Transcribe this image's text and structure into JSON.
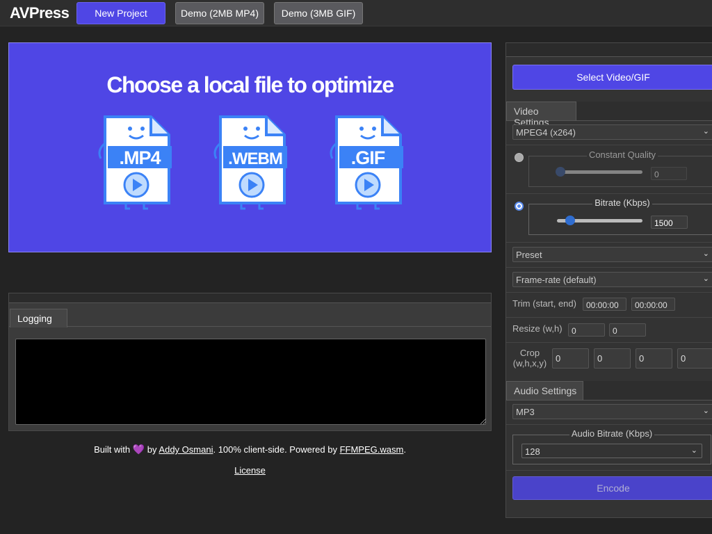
{
  "app": {
    "title": "AVPress"
  },
  "toolbar": {
    "new_project": "New Project",
    "demo_mp4": "Demo (2MB MP4)",
    "demo_gif": "Demo (3MB GIF)"
  },
  "dropzone": {
    "title": "Choose a local file to optimize",
    "files": [
      ".MP4",
      ".WEBM",
      ".GIF"
    ]
  },
  "logging": {
    "tab": "Logging",
    "content": ""
  },
  "footer": {
    "built_with": "Built with",
    "by": "by",
    "author": "Addy Osmani",
    "middle": ". 100% client-side. Powered by",
    "ffmpeg": "FFMPEG.wasm",
    "end": ".",
    "license": "License"
  },
  "settings": {
    "select_button": "Select Video/GIF",
    "video_tab": "Video Settings",
    "codec": "MPEG4 (x264)",
    "constant_quality": {
      "label": "Constant Quality",
      "value": "0",
      "selected": false
    },
    "bitrate": {
      "label": "Bitrate (Kbps)",
      "value": "1500",
      "selected": true
    },
    "preset": "Preset",
    "framerate": "Frame-rate (default)",
    "trim": {
      "label": "Trim (start, end)",
      "start": "00:00:00",
      "end": "00:00:00"
    },
    "resize": {
      "label": "Resize (w,h)",
      "w": "0",
      "h": "0"
    },
    "crop": {
      "label_line1": "Crop",
      "label_line2": "(w,h,x,y)",
      "w": "0",
      "h": "0",
      "x": "0",
      "y": "0"
    },
    "audio_tab": "Audio Settings",
    "audio_codec": "MP3",
    "audio_bitrate": {
      "label": "Audio Bitrate (Kbps)",
      "value": "128"
    },
    "encode": "Encode"
  },
  "colors": {
    "accent": "#4f46e5",
    "file_icon": "#3b82f6",
    "background": "#232323"
  }
}
